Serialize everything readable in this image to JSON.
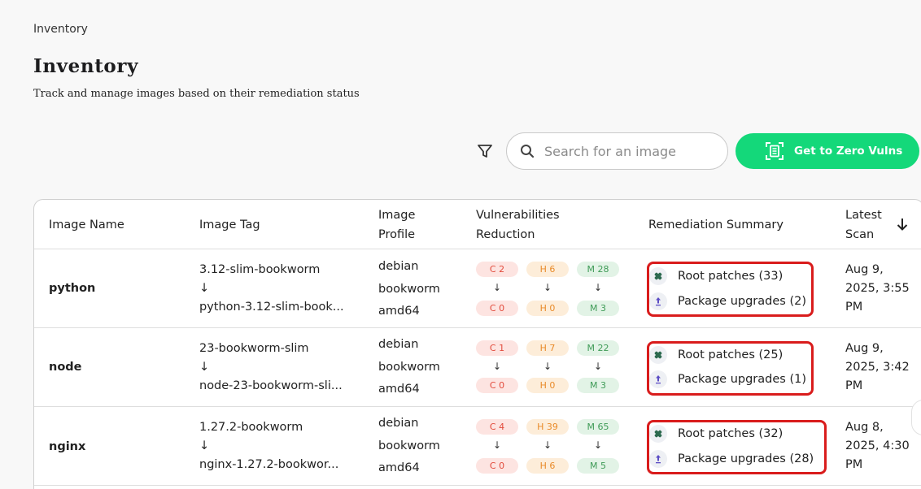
{
  "breadcrumb": "Inventory",
  "title": "Inventory",
  "subtitle": "Track and manage images based on their remediation status",
  "search": {
    "placeholder": "Search for an image"
  },
  "cta_label": "Get to Zero Vulns",
  "colors": {
    "accent": "#14d87a",
    "highlight": "#d91c1c"
  },
  "columns": {
    "name": "Image Name",
    "tag": "Image Tag",
    "profile_1": "Image",
    "profile_2": "Profile",
    "vuln_1": "Vulnerabilities",
    "vuln_2": "Reduction",
    "summary": "Remediation Summary",
    "scan_1": "Latest",
    "scan_2": "Scan"
  },
  "rows": [
    {
      "name": "python",
      "tag_from": "3.12-slim-bookworm",
      "arrow": "↓",
      "tag_to": "python-3.12-slim-book...",
      "profile": [
        "debian",
        "bookworm",
        "amd64"
      ],
      "vulns_before": {
        "c": "C 2",
        "h": "H 6",
        "m": "M 28"
      },
      "vulns_after": {
        "c": "C 0",
        "h": "H 0",
        "m": "M 3"
      },
      "root_patches": "Root patches (33)",
      "package_upgrades": "Package upgrades (2)",
      "scan": [
        "Aug 9,",
        "2025, 3:55",
        "PM"
      ]
    },
    {
      "name": "node",
      "tag_from": "23-bookworm-slim",
      "arrow": "↓",
      "tag_to": "node-23-bookworm-sli...",
      "profile": [
        "debian",
        "bookworm",
        "amd64"
      ],
      "vulns_before": {
        "c": "C 1",
        "h": "H 7",
        "m": "M 22"
      },
      "vulns_after": {
        "c": "C 0",
        "h": "H 0",
        "m": "M 3"
      },
      "root_patches": "Root patches (25)",
      "package_upgrades": "Package upgrades (1)",
      "scan": [
        "Aug 9,",
        "2025, 3:42",
        "PM"
      ]
    },
    {
      "name": "nginx",
      "tag_from": "1.27.2-bookworm",
      "arrow": "↓",
      "tag_to": "nginx-1.27.2-bookwor...",
      "profile": [
        "debian",
        "bookworm",
        "amd64"
      ],
      "vulns_before": {
        "c": "C 4",
        "h": "H 39",
        "m": "M 65"
      },
      "vulns_after": {
        "c": "C 0",
        "h": "H 6",
        "m": "M 5"
      },
      "root_patches": "Root patches (32)",
      "package_upgrades": "Package upgrades (28)",
      "scan": [
        "Aug 8,",
        "2025, 4:30",
        "PM"
      ]
    }
  ]
}
